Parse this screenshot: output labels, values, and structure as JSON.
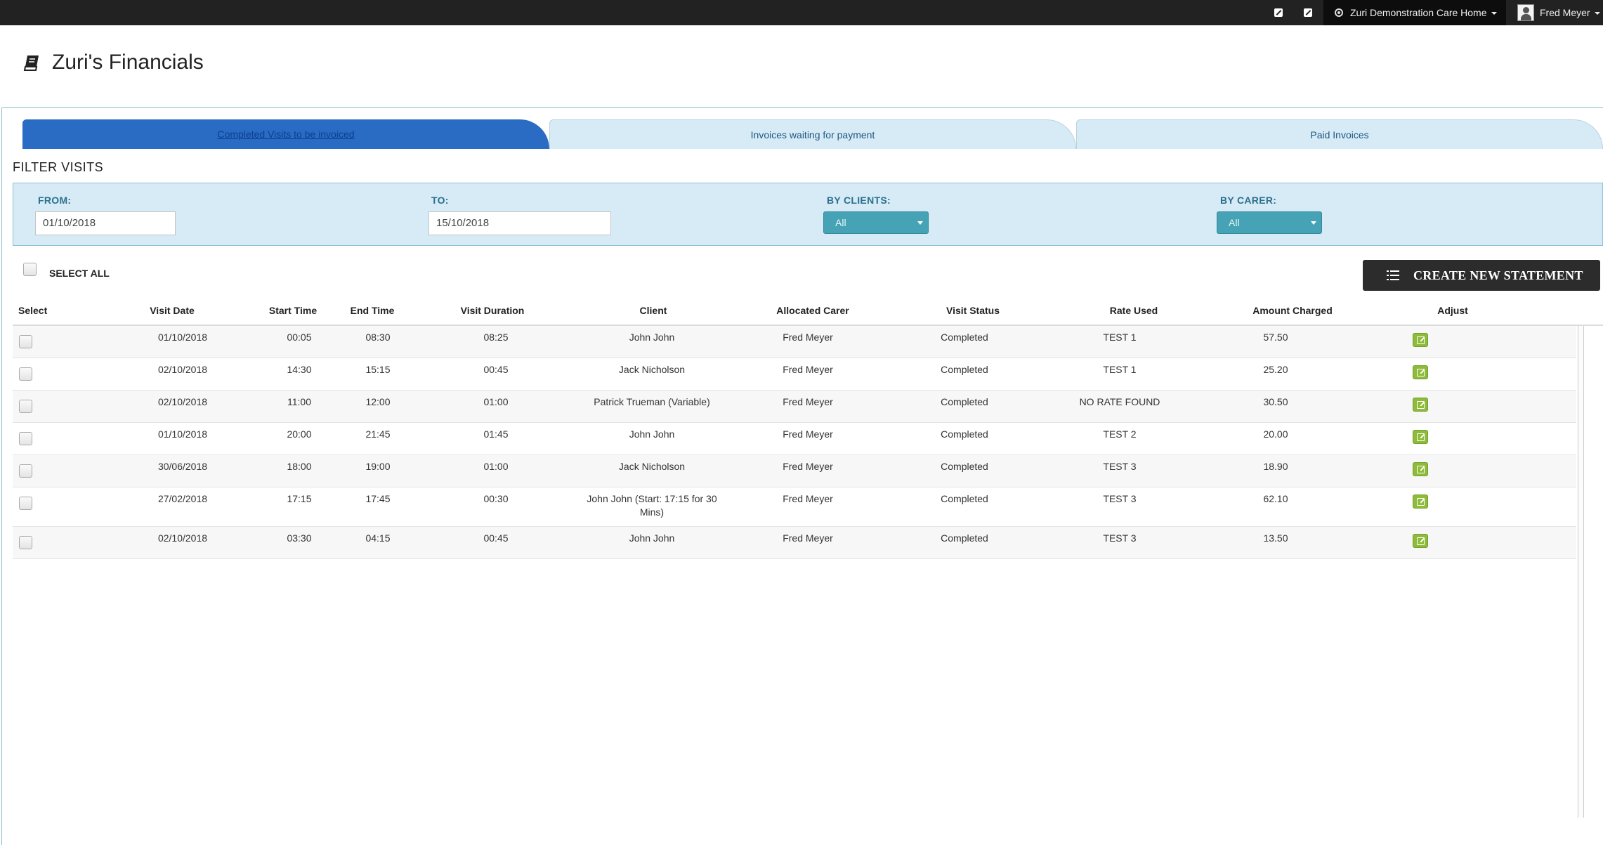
{
  "topbar": {
    "care_home": "Zuri Demonstration Care Home",
    "user_name": "Fred Meyer",
    "icon1": "edit-icon",
    "icon2": "edit-icon"
  },
  "page": {
    "title": "Zuri's Financials",
    "title_icon": "book-icon"
  },
  "tabs": [
    {
      "label": "Completed Visits to be invoiced",
      "active": true
    },
    {
      "label": "Invoices waiting for payment",
      "active": false
    },
    {
      "label": "Paid Invoices",
      "active": false
    }
  ],
  "filter": {
    "title": "FILTER VISITS",
    "from_label": "FROM:",
    "from_value": "01/10/2018",
    "to_label": "TO:",
    "to_value": "15/10/2018",
    "clients_label": "BY CLIENTS:",
    "clients_value": "All",
    "carer_label": "BY CARER:",
    "carer_value": "All"
  },
  "select_all_label": "SELECT ALL",
  "create_button_label": "CREATE NEW STATEMENT",
  "table": {
    "headers": [
      "Select",
      "Visit Date",
      "Start Time",
      "End Time",
      "Visit Duration",
      "Client",
      "Allocated Carer",
      "Visit Status",
      "Rate Used",
      "Amount Charged",
      "Adjust"
    ],
    "rows": [
      {
        "date": "01/10/2018",
        "start": "00:05",
        "end": "08:30",
        "duration": "08:25",
        "client": "John John",
        "carer": "Fred Meyer",
        "status": "Completed",
        "rate": "TEST 1",
        "amount": "57.50"
      },
      {
        "date": "02/10/2018",
        "start": "14:30",
        "end": "15:15",
        "duration": "00:45",
        "client": "Jack Nicholson",
        "carer": "Fred Meyer",
        "status": "Completed",
        "rate": "TEST 1",
        "amount": "25.20"
      },
      {
        "date": "02/10/2018",
        "start": "11:00",
        "end": "12:00",
        "duration": "01:00",
        "client": "Patrick Trueman (Variable)",
        "carer": "Fred Meyer",
        "status": "Completed",
        "rate": "NO RATE FOUND",
        "amount": "30.50"
      },
      {
        "date": "01/10/2018",
        "start": "20:00",
        "end": "21:45",
        "duration": "01:45",
        "client": "John John",
        "carer": "Fred Meyer",
        "status": "Completed",
        "rate": "TEST 2",
        "amount": "20.00"
      },
      {
        "date": "30/06/2018",
        "start": "18:00",
        "end": "19:00",
        "duration": "01:00",
        "client": "Jack Nicholson",
        "carer": "Fred Meyer",
        "status": "Completed",
        "rate": "TEST 3",
        "amount": "18.90"
      },
      {
        "date": "27/02/2018",
        "start": "17:15",
        "end": "17:45",
        "duration": "00:30",
        "client": "John John (Start: 17:15 for 30 Mins)",
        "carer": "Fred Meyer",
        "status": "Completed",
        "rate": "TEST 3",
        "amount": "62.10"
      },
      {
        "date": "02/10/2018",
        "start": "03:30",
        "end": "04:15",
        "duration": "00:45",
        "client": "John John",
        "carer": "Fred Meyer",
        "status": "Completed",
        "rate": "TEST 3",
        "amount": "13.50"
      }
    ]
  }
}
